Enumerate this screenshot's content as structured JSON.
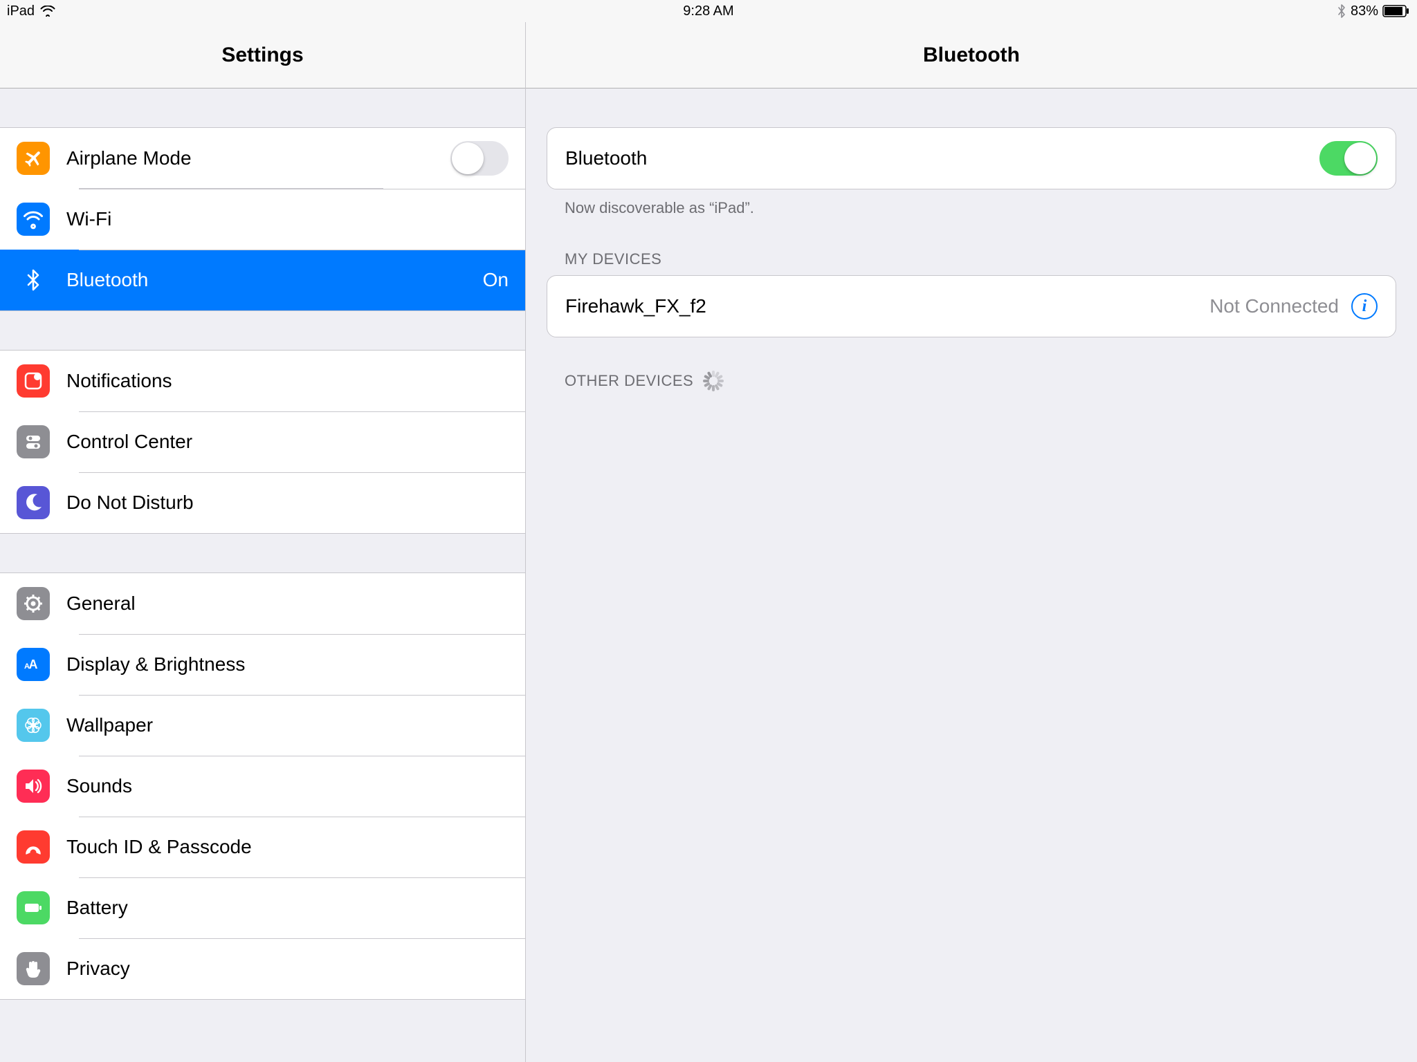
{
  "statusbar": {
    "device": "iPad",
    "time": "9:28 AM",
    "battery_pct": "83%"
  },
  "sidebar": {
    "title": "Settings",
    "groups": [
      {
        "items": [
          {
            "id": "airplane",
            "label": "Airplane Mode",
            "value": "",
            "icon": "airplane-icon",
            "color": "#ff9500",
            "toggle": false
          },
          {
            "id": "wifi",
            "label": "Wi-Fi",
            "value": "",
            "icon": "wifi-icon",
            "color": "#007aff"
          },
          {
            "id": "bluetooth",
            "label": "Bluetooth",
            "value": "On",
            "icon": "bluetooth-icon",
            "color": "#007aff",
            "selected": true
          }
        ]
      },
      {
        "items": [
          {
            "id": "notifications",
            "label": "Notifications",
            "icon": "notifications-icon",
            "color": "#ff3b30"
          },
          {
            "id": "controlcenter",
            "label": "Control Center",
            "icon": "controlcenter-icon",
            "color": "#8e8e93"
          },
          {
            "id": "dnd",
            "label": "Do Not Disturb",
            "icon": "moon-icon",
            "color": "#5856d6"
          }
        ]
      },
      {
        "items": [
          {
            "id": "general",
            "label": "General",
            "icon": "gear-icon",
            "color": "#8e8e93"
          },
          {
            "id": "display",
            "label": "Display & Brightness",
            "icon": "display-icon",
            "color": "#007aff"
          },
          {
            "id": "wallpaper",
            "label": "Wallpaper",
            "icon": "wallpaper-icon",
            "color": "#54c7ec"
          },
          {
            "id": "sounds",
            "label": "Sounds",
            "icon": "sounds-icon",
            "color": "#ff2d55"
          },
          {
            "id": "touchid",
            "label": "Touch ID & Passcode",
            "icon": "fingerprint-icon",
            "color": "#ff3b30"
          },
          {
            "id": "battery",
            "label": "Battery",
            "icon": "battery-icon",
            "color": "#4cd964"
          },
          {
            "id": "privacy",
            "label": "Privacy",
            "icon": "hand-icon",
            "color": "#8e8e93"
          }
        ]
      }
    ]
  },
  "detail": {
    "title": "Bluetooth",
    "toggle_label": "Bluetooth",
    "toggle_on": true,
    "discoverable_text": "Now discoverable as “iPad”.",
    "my_devices_header": "MY DEVICES",
    "my_devices": [
      {
        "name": "Firehawk_FX_f2",
        "status": "Not Connected"
      }
    ],
    "other_devices_header": "OTHER DEVICES"
  }
}
